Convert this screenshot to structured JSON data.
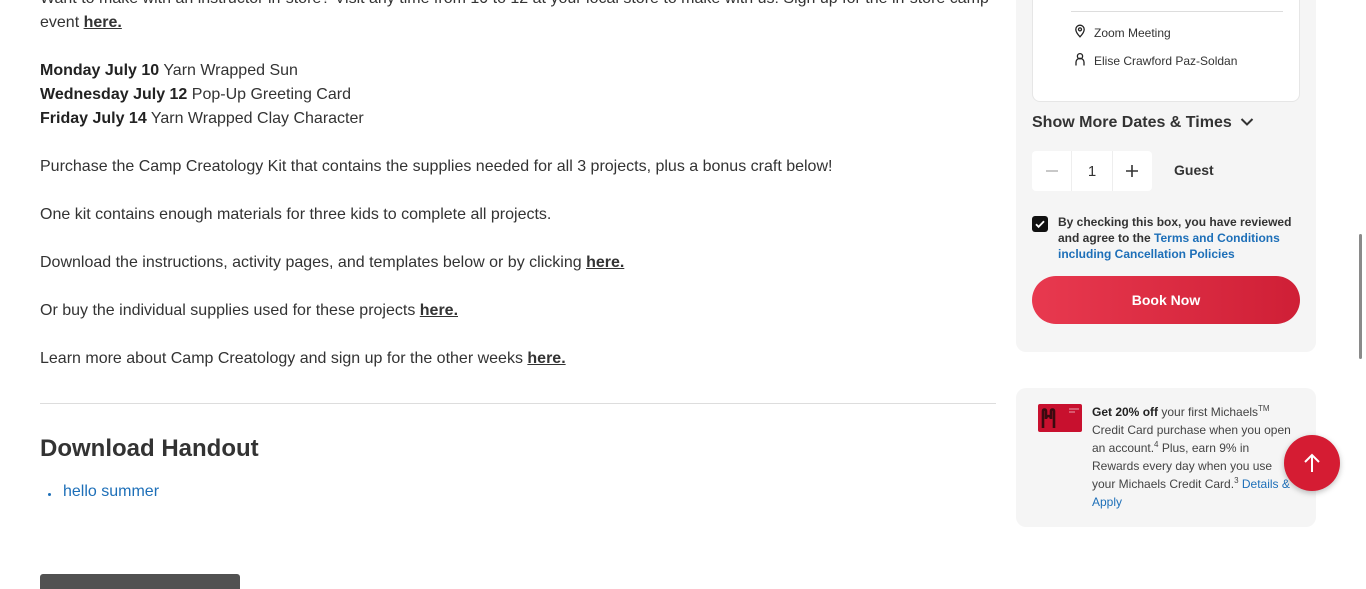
{
  "main": {
    "intro": {
      "text": "Want to make with an instructor in-store? Visit any time from 10 to 12 at your local store to make with us! Sign up for the in-store camp event ",
      "link": "here."
    },
    "schedule": [
      {
        "day": "Monday July 10",
        "project": " Yarn Wrapped Sun"
      },
      {
        "day": "Wednesday July 12",
        "project": " Pop-Up Greeting Card"
      },
      {
        "day": "Friday July 14",
        "project": " Yarn Wrapped Clay Character"
      }
    ],
    "purchase_text": "Purchase the Camp Creatology Kit that contains the supplies needed for all 3 projects, plus a bonus craft below!",
    "kit_text": "One kit contains enough materials for three kids to complete all projects.",
    "download": {
      "text": "Download the instructions, activity pages, and templates below or by clicking ",
      "link": "here."
    },
    "supplies": {
      "text": "Or buy the individual supplies used for these projects ",
      "link": "here."
    },
    "learn_more": {
      "text": "Learn more about Camp Creatology and sign up for the other weeks ",
      "link": "here."
    },
    "handout_title": "Download Handout",
    "handout_items": [
      "hello summer"
    ]
  },
  "sidebar": {
    "location": "Zoom Meeting",
    "instructor": "Elise Crawford Paz-Soldan",
    "more_dates": "Show More Dates & Times",
    "quantity": "1",
    "guest_label": "Guest",
    "agree": {
      "text": "By checking this box, you have reviewed and agree to the ",
      "link": "Terms and Conditions including Cancellation Policies",
      "checked": true
    },
    "book_now": "Book Now",
    "promo": {
      "bold": "Get 20% off",
      "text1": " your first Michaels",
      "tm": "TM",
      "text2": " Credit Card purchase when you open an account.",
      "sup4": "4",
      "text3": " Plus, earn 9% in Rewards every day when you use your Michaels Credit Card.",
      "sup3": "3",
      "link": " Details & Apply"
    }
  },
  "colors": {
    "accent_red": "#d51c33",
    "link_blue": "#1d6fb8"
  }
}
